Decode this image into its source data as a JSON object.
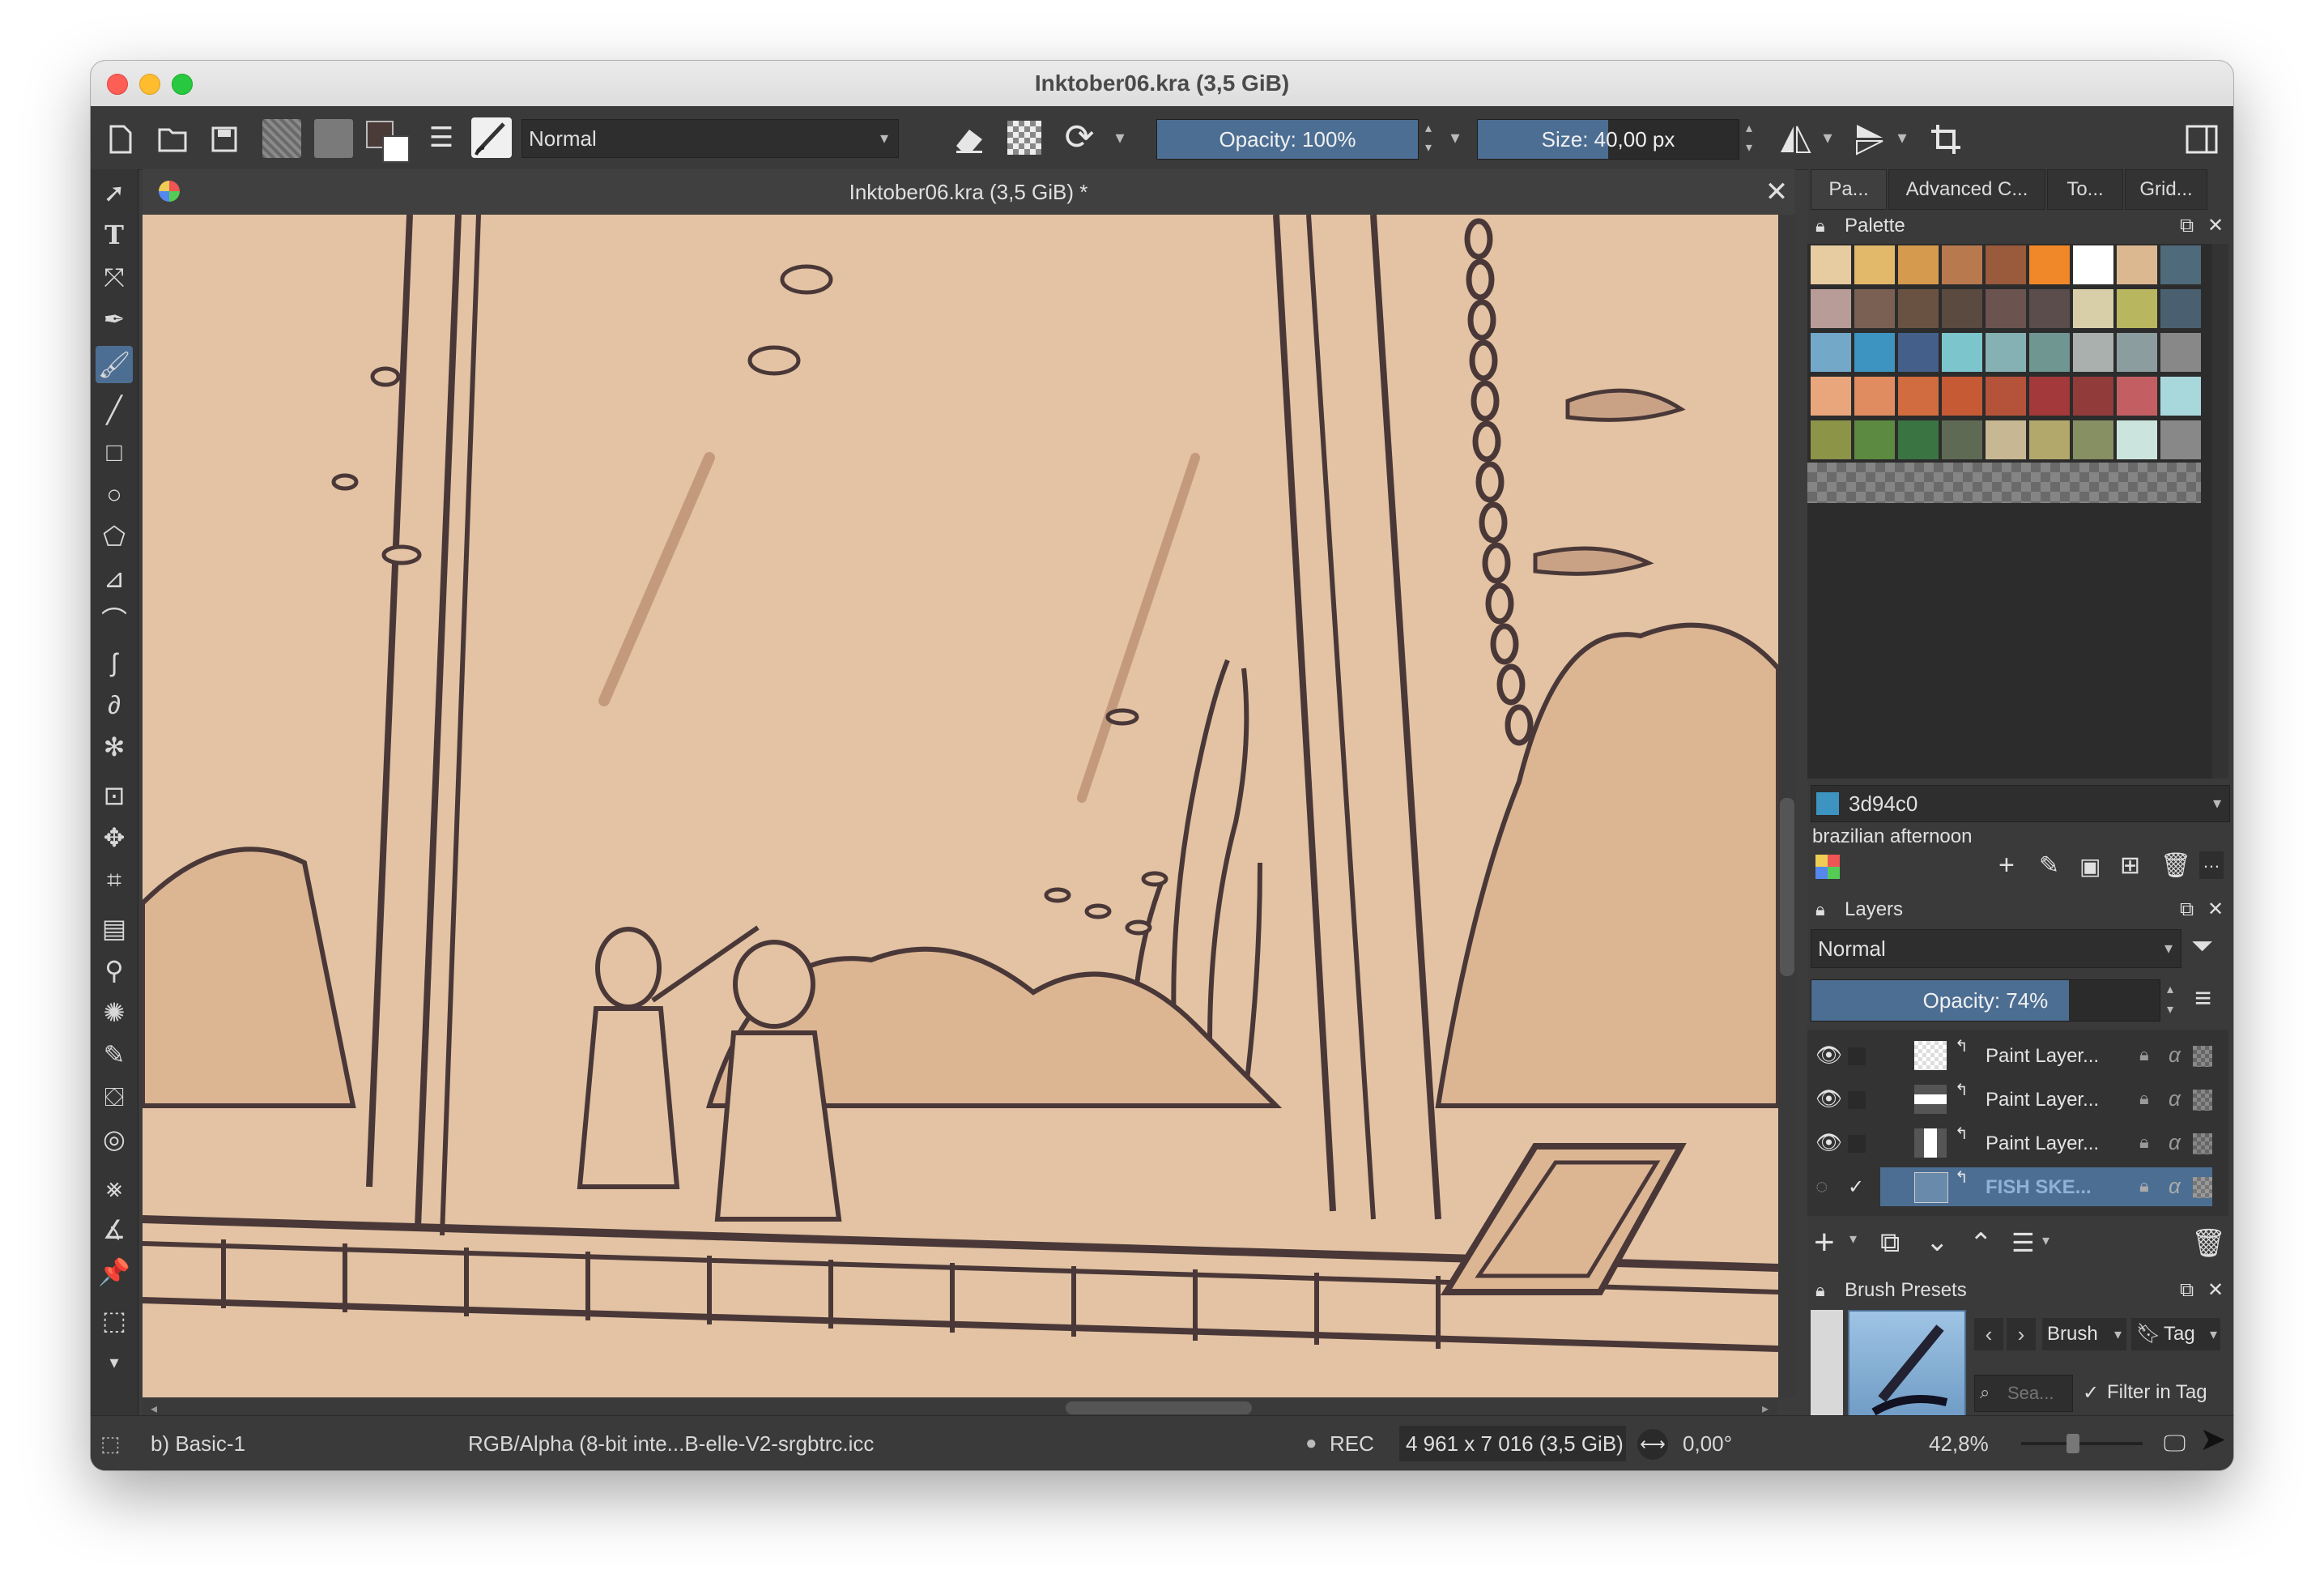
{
  "window": {
    "title": "Inktober06.kra (3,5 GiB)"
  },
  "toolbar": {
    "blend_mode": "Normal",
    "opacity_label": "Opacity: 100%",
    "opacity_value": 1.0,
    "size_label": "Size: 40,00 px",
    "size_value": 0.5
  },
  "document": {
    "tab_title": "Inktober06.kra (3,5 GiB) *"
  },
  "docker": {
    "tabs": [
      "Pa...",
      "Advanced C...",
      "To...",
      "Grid..."
    ],
    "palette": {
      "title": "Palette",
      "colors": [
        [
          "#e6cca0",
          "#e2b86a",
          "#d59a4e",
          "#b9794f",
          "#9a5a3c",
          "#f0882a",
          "#ffffff",
          "#dcb890",
          "#4f6a7a"
        ],
        [
          "#b79c98",
          "#7a6052",
          "#6a5242",
          "#5a4a3f",
          "#6b5350",
          "#5a4d4c",
          "#d8cfa8",
          "#b9b660",
          "#4a6070"
        ],
        [
          "#74a8c8",
          "#3e94c0",
          "#44608a",
          "#7cc5cd",
          "#86b1b4",
          "#6f9690",
          "#a9b0ad",
          "#8c9da0",
          "#888888"
        ],
        [
          "#e9a67c",
          "#e08c60",
          "#d06c40",
          "#c55a35",
          "#b5533a",
          "#a3393a",
          "#913b3a",
          "#c35f62",
          "#a8d8dc"
        ],
        [
          "#8c9448",
          "#5b8a40",
          "#3a7442",
          "#5f6a55",
          "#c7b793",
          "#b2a86b",
          "#869062",
          "#cce4de",
          "#888888"
        ]
      ],
      "selected_hex": "3d94c0",
      "selected_color": "#3d94c0",
      "palette_name": "brazilian afternoon"
    },
    "layers": {
      "title": "Layers",
      "blend_mode": "Normal",
      "opacity_label": "Opacity:  74%",
      "opacity_value": 0.74,
      "items": [
        {
          "name": "Paint Layer...",
          "selected": false
        },
        {
          "name": "Paint Layer...",
          "selected": false
        },
        {
          "name": "Paint Layer...",
          "selected": false
        },
        {
          "name": "FISH SKE...",
          "selected": true
        }
      ]
    },
    "brush_presets": {
      "title": "Brush Presets",
      "dropdown": "Brush",
      "tag_label": "Tag",
      "search_placeholder": "Sea...",
      "filter_label": "Filter in Tag"
    }
  },
  "status": {
    "brush": "b) Basic-1",
    "color_profile": "RGB/Alpha (8-bit inte...B-elle-V2-srgbtrc.icc",
    "rec": "REC",
    "dimensions": "4 961 x 7 016 (3,5 GiB)",
    "rotation": "0,00°",
    "zoom": "42,8%"
  }
}
